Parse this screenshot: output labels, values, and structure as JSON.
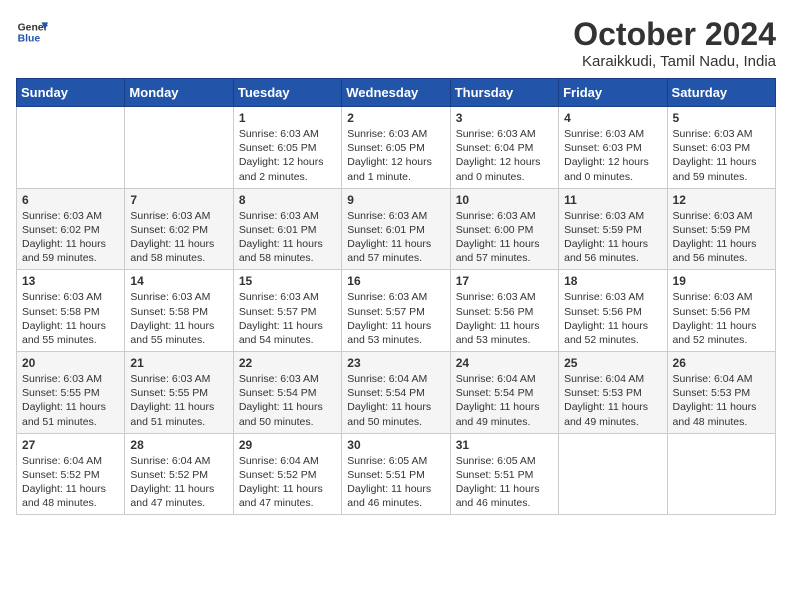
{
  "header": {
    "logo_general": "General",
    "logo_blue": "Blue",
    "month_title": "October 2024",
    "subtitle": "Karaikkudi, Tamil Nadu, India"
  },
  "weekdays": [
    "Sunday",
    "Monday",
    "Tuesday",
    "Wednesday",
    "Thursday",
    "Friday",
    "Saturday"
  ],
  "weeks": [
    [
      {
        "day": "",
        "info": ""
      },
      {
        "day": "",
        "info": ""
      },
      {
        "day": "1",
        "info": "Sunrise: 6:03 AM\nSunset: 6:05 PM\nDaylight: 12 hours\nand 2 minutes."
      },
      {
        "day": "2",
        "info": "Sunrise: 6:03 AM\nSunset: 6:05 PM\nDaylight: 12 hours\nand 1 minute."
      },
      {
        "day": "3",
        "info": "Sunrise: 6:03 AM\nSunset: 6:04 PM\nDaylight: 12 hours\nand 0 minutes."
      },
      {
        "day": "4",
        "info": "Sunrise: 6:03 AM\nSunset: 6:03 PM\nDaylight: 12 hours\nand 0 minutes."
      },
      {
        "day": "5",
        "info": "Sunrise: 6:03 AM\nSunset: 6:03 PM\nDaylight: 11 hours\nand 59 minutes."
      }
    ],
    [
      {
        "day": "6",
        "info": "Sunrise: 6:03 AM\nSunset: 6:02 PM\nDaylight: 11 hours\nand 59 minutes."
      },
      {
        "day": "7",
        "info": "Sunrise: 6:03 AM\nSunset: 6:02 PM\nDaylight: 11 hours\nand 58 minutes."
      },
      {
        "day": "8",
        "info": "Sunrise: 6:03 AM\nSunset: 6:01 PM\nDaylight: 11 hours\nand 58 minutes."
      },
      {
        "day": "9",
        "info": "Sunrise: 6:03 AM\nSunset: 6:01 PM\nDaylight: 11 hours\nand 57 minutes."
      },
      {
        "day": "10",
        "info": "Sunrise: 6:03 AM\nSunset: 6:00 PM\nDaylight: 11 hours\nand 57 minutes."
      },
      {
        "day": "11",
        "info": "Sunrise: 6:03 AM\nSunset: 5:59 PM\nDaylight: 11 hours\nand 56 minutes."
      },
      {
        "day": "12",
        "info": "Sunrise: 6:03 AM\nSunset: 5:59 PM\nDaylight: 11 hours\nand 56 minutes."
      }
    ],
    [
      {
        "day": "13",
        "info": "Sunrise: 6:03 AM\nSunset: 5:58 PM\nDaylight: 11 hours\nand 55 minutes."
      },
      {
        "day": "14",
        "info": "Sunrise: 6:03 AM\nSunset: 5:58 PM\nDaylight: 11 hours\nand 55 minutes."
      },
      {
        "day": "15",
        "info": "Sunrise: 6:03 AM\nSunset: 5:57 PM\nDaylight: 11 hours\nand 54 minutes."
      },
      {
        "day": "16",
        "info": "Sunrise: 6:03 AM\nSunset: 5:57 PM\nDaylight: 11 hours\nand 53 minutes."
      },
      {
        "day": "17",
        "info": "Sunrise: 6:03 AM\nSunset: 5:56 PM\nDaylight: 11 hours\nand 53 minutes."
      },
      {
        "day": "18",
        "info": "Sunrise: 6:03 AM\nSunset: 5:56 PM\nDaylight: 11 hours\nand 52 minutes."
      },
      {
        "day": "19",
        "info": "Sunrise: 6:03 AM\nSunset: 5:56 PM\nDaylight: 11 hours\nand 52 minutes."
      }
    ],
    [
      {
        "day": "20",
        "info": "Sunrise: 6:03 AM\nSunset: 5:55 PM\nDaylight: 11 hours\nand 51 minutes."
      },
      {
        "day": "21",
        "info": "Sunrise: 6:03 AM\nSunset: 5:55 PM\nDaylight: 11 hours\nand 51 minutes."
      },
      {
        "day": "22",
        "info": "Sunrise: 6:03 AM\nSunset: 5:54 PM\nDaylight: 11 hours\nand 50 minutes."
      },
      {
        "day": "23",
        "info": "Sunrise: 6:04 AM\nSunset: 5:54 PM\nDaylight: 11 hours\nand 50 minutes."
      },
      {
        "day": "24",
        "info": "Sunrise: 6:04 AM\nSunset: 5:54 PM\nDaylight: 11 hours\nand 49 minutes."
      },
      {
        "day": "25",
        "info": "Sunrise: 6:04 AM\nSunset: 5:53 PM\nDaylight: 11 hours\nand 49 minutes."
      },
      {
        "day": "26",
        "info": "Sunrise: 6:04 AM\nSunset: 5:53 PM\nDaylight: 11 hours\nand 48 minutes."
      }
    ],
    [
      {
        "day": "27",
        "info": "Sunrise: 6:04 AM\nSunset: 5:52 PM\nDaylight: 11 hours\nand 48 minutes."
      },
      {
        "day": "28",
        "info": "Sunrise: 6:04 AM\nSunset: 5:52 PM\nDaylight: 11 hours\nand 47 minutes."
      },
      {
        "day": "29",
        "info": "Sunrise: 6:04 AM\nSunset: 5:52 PM\nDaylight: 11 hours\nand 47 minutes."
      },
      {
        "day": "30",
        "info": "Sunrise: 6:05 AM\nSunset: 5:51 PM\nDaylight: 11 hours\nand 46 minutes."
      },
      {
        "day": "31",
        "info": "Sunrise: 6:05 AM\nSunset: 5:51 PM\nDaylight: 11 hours\nand 46 minutes."
      },
      {
        "day": "",
        "info": ""
      },
      {
        "day": "",
        "info": ""
      }
    ]
  ]
}
